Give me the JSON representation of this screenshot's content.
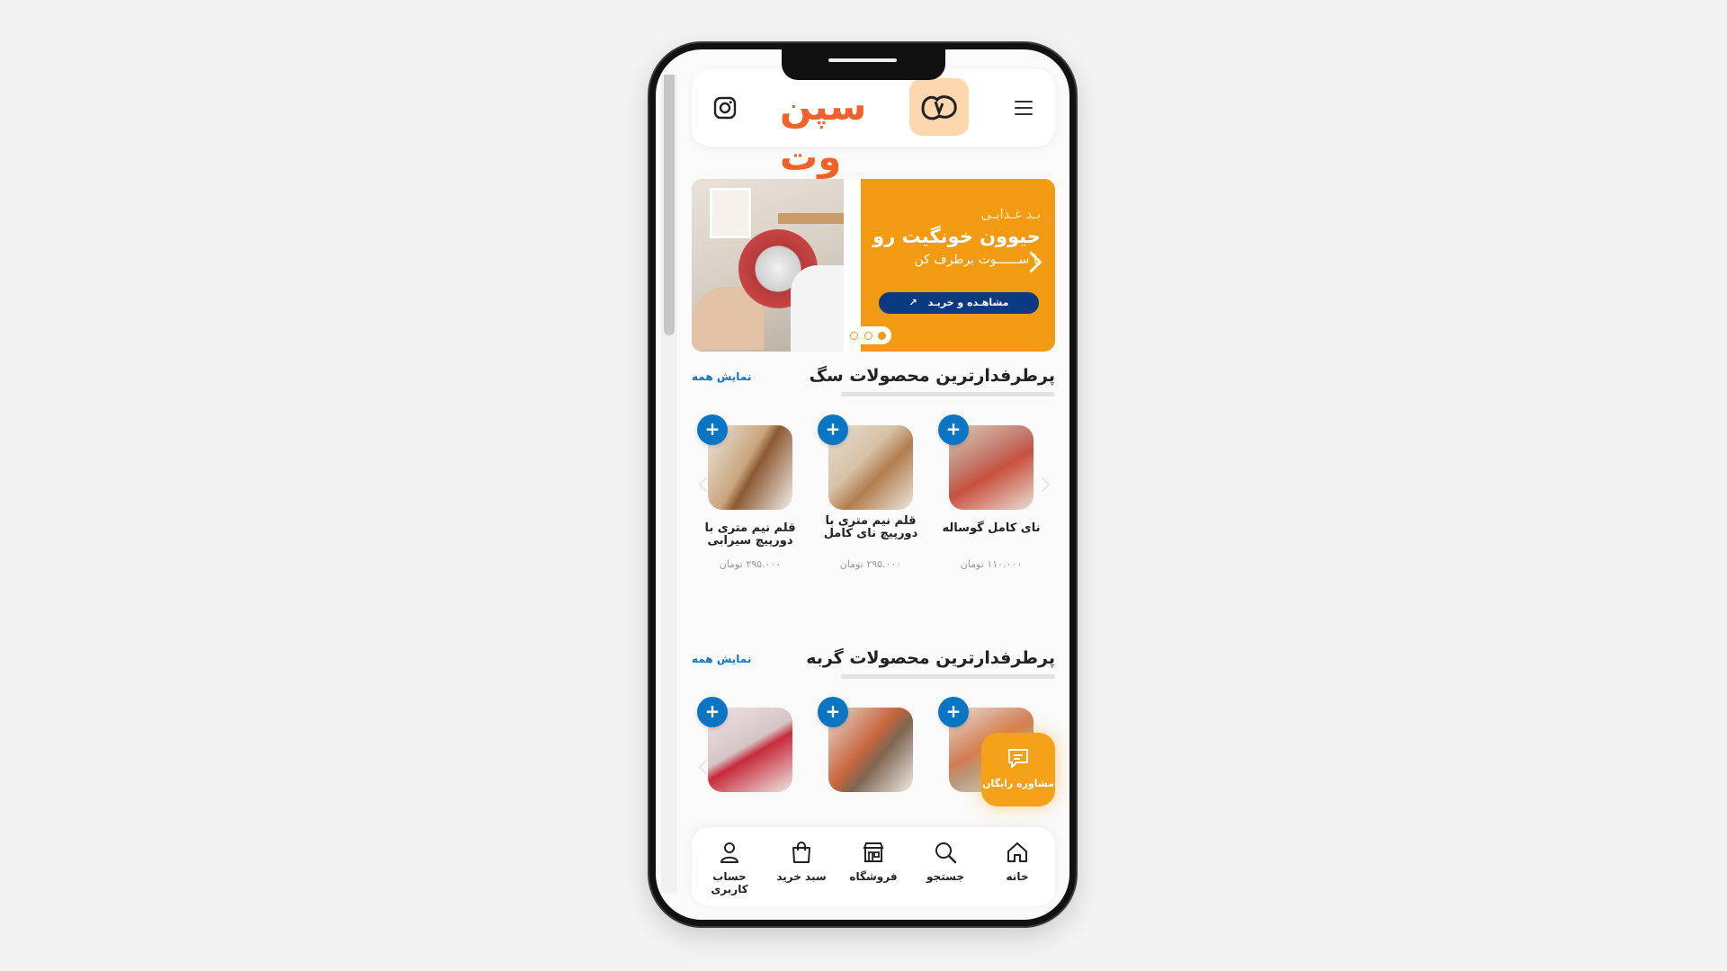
{
  "brand": {
    "logo_text": "سپن وت"
  },
  "banner": {
    "line1": "بـد غـذایـی",
    "line2": "حیوون خونگیت رو",
    "line3": "با ســــــوت برطرف کن",
    "cta": "مشاهـده و خریـد",
    "dots": 3,
    "active_dot": 0
  },
  "sections": [
    {
      "title": "پرطرفدارترین محصولات سگ",
      "show_all": "نمایش همه",
      "products": [
        {
          "name": "نای کامل گوساله",
          "price": "۱۱۰.۰۰۰",
          "currency": "تومان"
        },
        {
          "name": "قلم نیم متری با دورپیچ نای کامل",
          "price": "۲۹۵.۰۰۰",
          "currency": "تومان"
        },
        {
          "name": "قلم نیم متری با دورپیچ سیرابی",
          "price": "۲۹۵.۰۰۰",
          "currency": "تومان"
        }
      ]
    },
    {
      "title": "پرطرفدارترین محصولات گربه",
      "show_all": "نمایش همه",
      "products": [
        {
          "name": "",
          "price": ""
        },
        {
          "name": "",
          "price": ""
        },
        {
          "name": "",
          "price": ""
        }
      ]
    }
  ],
  "consult": {
    "label": "مشاوره رایگان"
  },
  "bottom_nav": [
    {
      "label": "خانه",
      "icon": "home-icon"
    },
    {
      "label": "جستجو",
      "icon": "search-icon"
    },
    {
      "label": "فروشگاه",
      "icon": "store-icon"
    },
    {
      "label": "سبد خرید",
      "icon": "cart-icon"
    },
    {
      "label": "حساب کاربری",
      "icon": "user-icon"
    }
  ],
  "colors": {
    "accent_orange": "#f29b12",
    "brand_orange": "#f0622a",
    "blue": "#0a75c2",
    "navy": "#0b3a83"
  }
}
